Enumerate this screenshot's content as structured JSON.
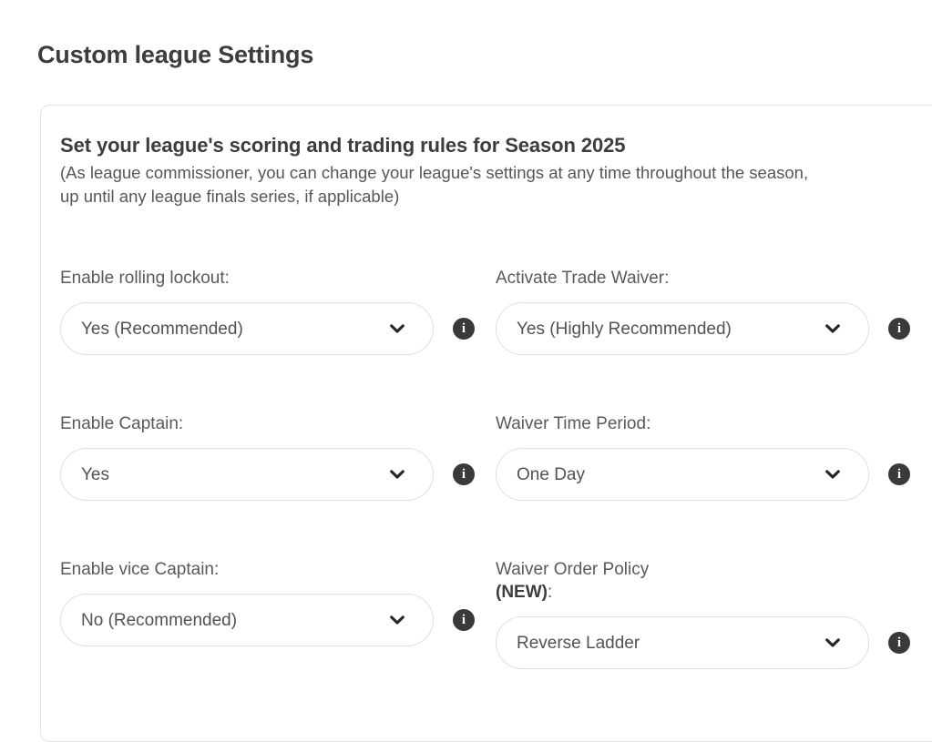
{
  "page": {
    "title": "Custom league Settings"
  },
  "card": {
    "heading": "Set your league's scoring and trading rules for Season 2025",
    "subtitle": "(As league commissioner, you can change your league's settings at any time throughout the season, up until any league finals series, if applicable)"
  },
  "icons": {
    "chevron": "chevron-down-icon",
    "info": "info-icon",
    "info_glyph": "i"
  },
  "colors": {
    "page_background": "#ffffff",
    "card_border": "#e4e4e4",
    "title_text": "#3d3d3d",
    "label_text": "#5a5a5a",
    "value_text": "#525252",
    "pill_border": "#e0e0e0",
    "info_icon_background": "#3a3a3a"
  },
  "fields": [
    {
      "id": "enable-rolling-lockout",
      "label": "Enable rolling lockout:",
      "value": "Yes (Recommended)"
    },
    {
      "id": "activate-trade-waiver",
      "label": "Activate Trade Waiver:",
      "value": "Yes (Highly Recommended)"
    },
    {
      "id": "enable-captain",
      "label": "Enable Captain:",
      "value": "Yes"
    },
    {
      "id": "waiver-time-period",
      "label": "Waiver Time Period:",
      "value": "One Day"
    },
    {
      "id": "enable-vice-captain",
      "label": "Enable vice Captain:",
      "value": "No (Recommended)"
    },
    {
      "id": "waiver-order-policy",
      "label_line1": "Waiver Order Policy",
      "label_new": "(NEW)",
      "label_suffix": ":",
      "value": "Reverse Ladder"
    }
  ]
}
